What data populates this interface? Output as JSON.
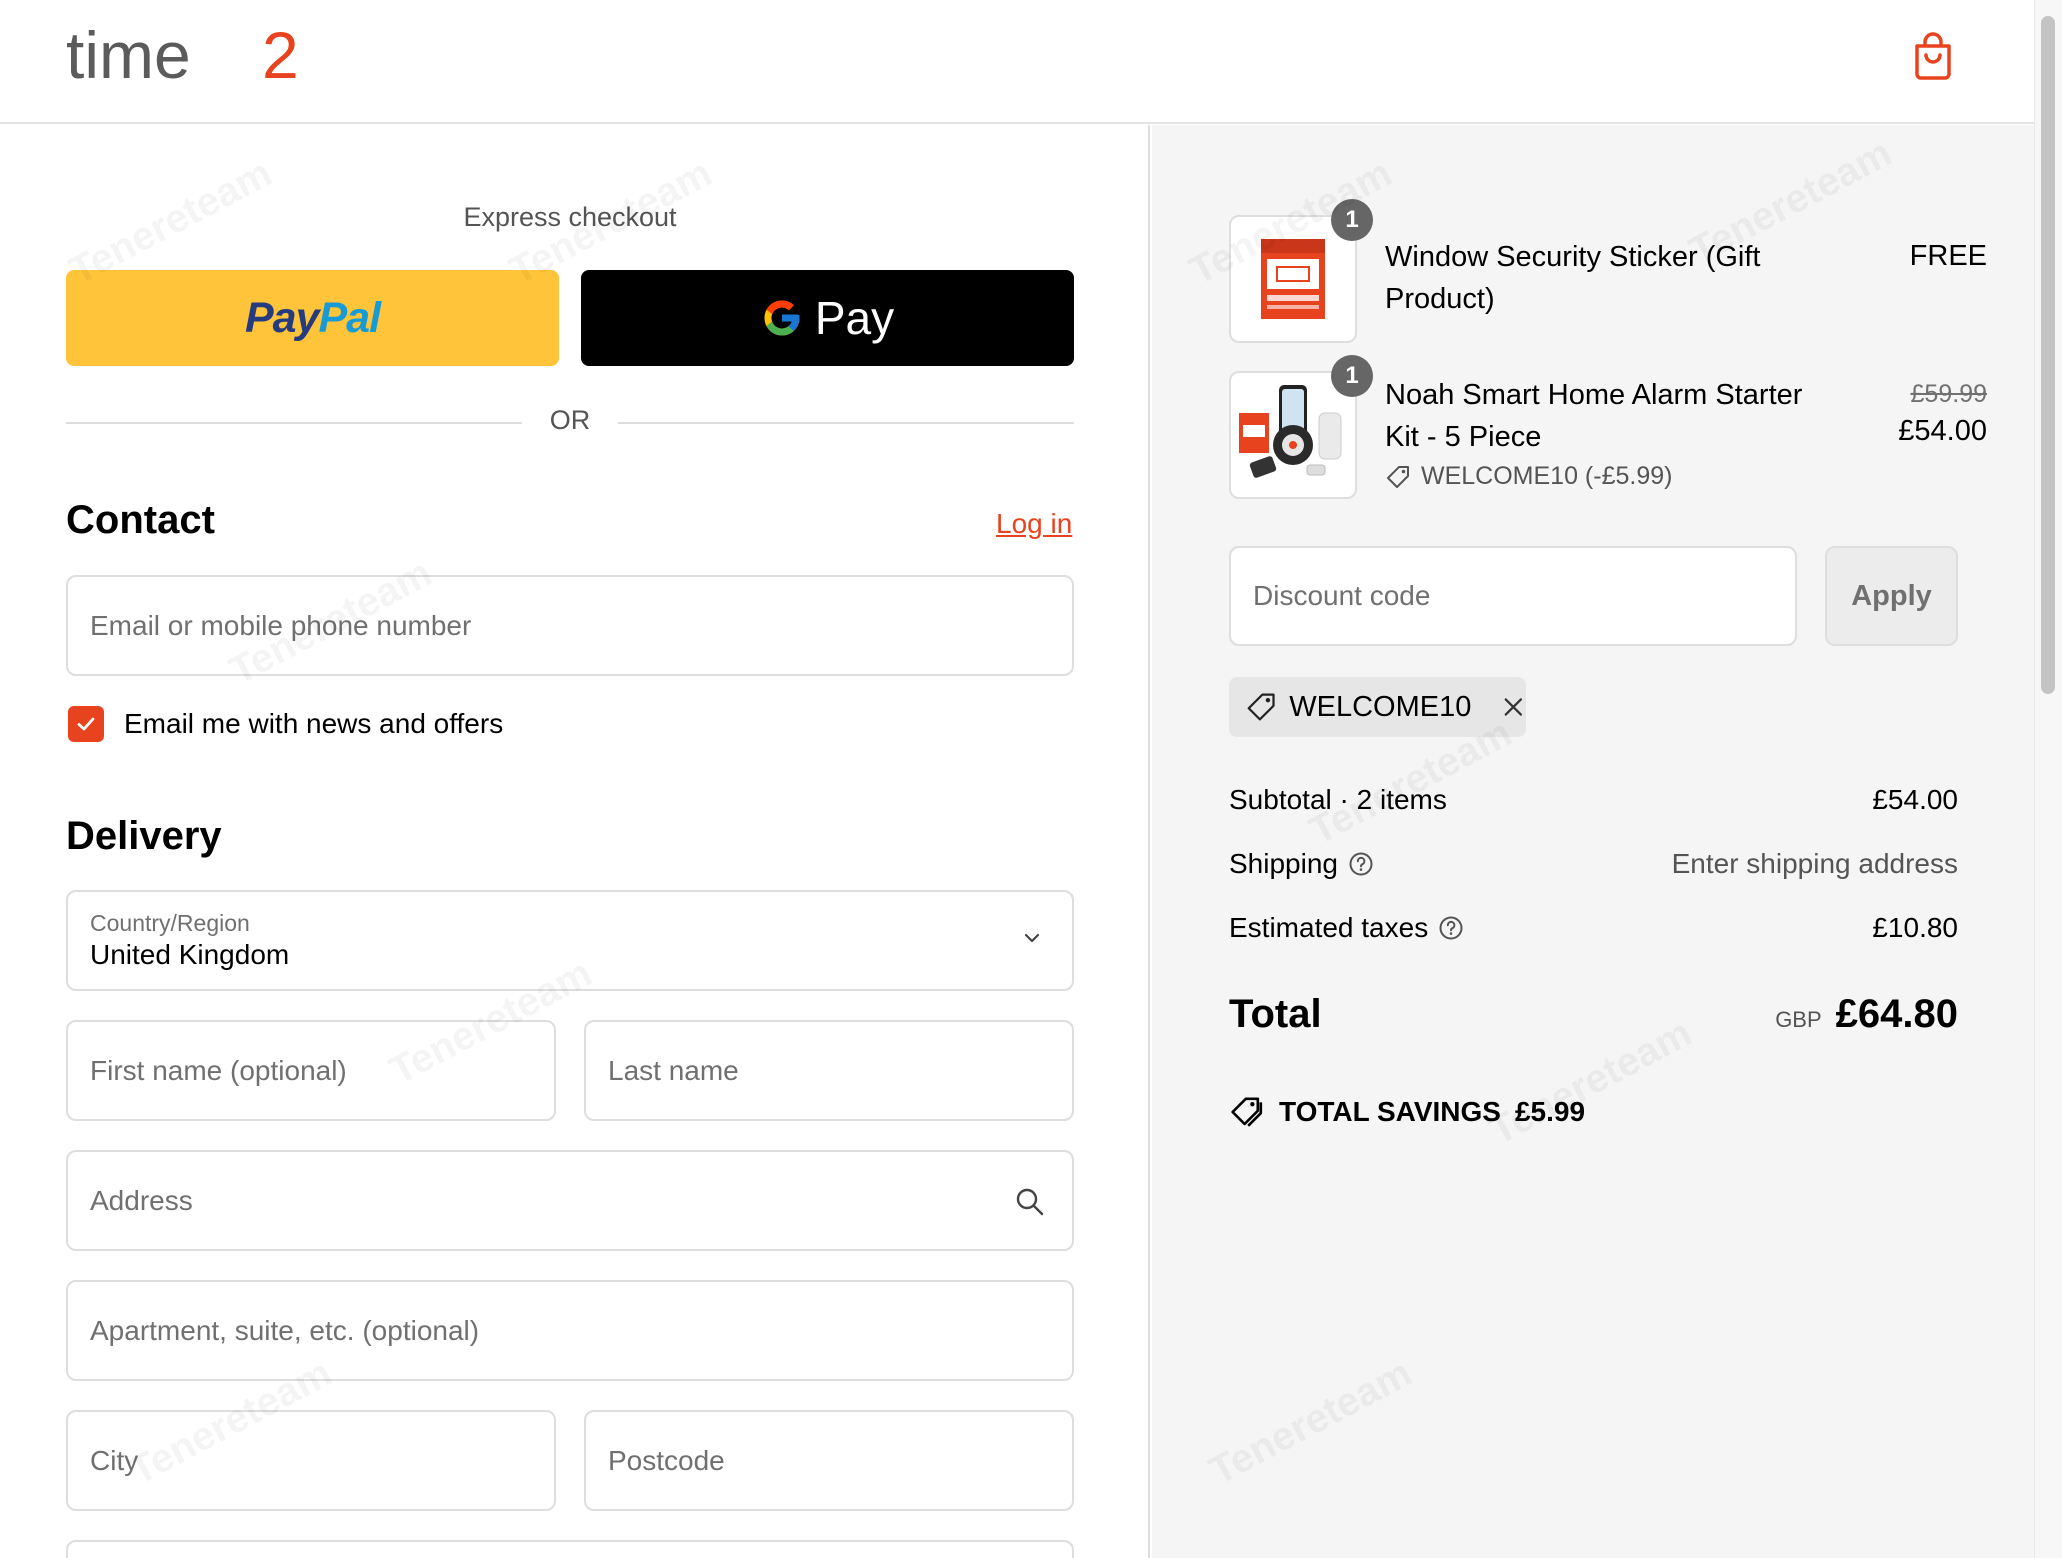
{
  "header": {
    "logo_text_dark": "time",
    "logo_text_accent": "2",
    "cart_icon": "shopping-bag-icon"
  },
  "express": {
    "label": "Express checkout",
    "paypal_label_1": "Pay",
    "paypal_label_2": "Pal",
    "gpay_label": "Pay",
    "or_label": "OR"
  },
  "contact": {
    "title": "Contact",
    "login_label": "Log in",
    "email_placeholder": "Email or mobile phone number",
    "newsletter_label": "Email me with news and offers",
    "newsletter_checked": true
  },
  "delivery": {
    "title": "Delivery",
    "country_label": "Country/Region",
    "country_value": "United Kingdom",
    "first_name_placeholder": "First name (optional)",
    "last_name_placeholder": "Last name",
    "address_placeholder": "Address",
    "apartment_placeholder": "Apartment, suite, etc. (optional)",
    "city_placeholder": "City",
    "postcode_placeholder": "Postcode"
  },
  "cart": {
    "items": [
      {
        "name_line1": "Window Security Sticker (Gift",
        "name_line2": "Product)",
        "qty": "1",
        "price": "FREE"
      },
      {
        "name_line1": "Noah Smart Home Alarm Starter",
        "name_line2": "Kit - 5 Piece",
        "qty": "1",
        "original_price": "£59.99",
        "price": "£54.00",
        "discount_label": "WELCOME10 (-£5.99)"
      }
    ],
    "discount_placeholder": "Discount code",
    "apply_label": "Apply",
    "applied_code": "WELCOME10"
  },
  "summary": {
    "subtotal_label": "Subtotal · 2 items",
    "subtotal_value": "£54.00",
    "shipping_label": "Shipping",
    "shipping_value": "Enter shipping address",
    "taxes_label": "Estimated taxes",
    "taxes_value": "£10.80",
    "total_label": "Total",
    "currency": "GBP",
    "total_value": "£64.80",
    "savings_label": "TOTAL SAVINGS",
    "savings_value": "£5.99"
  },
  "colors": {
    "accent": "#e8431f",
    "paypal_yellow": "#ffc439",
    "gpay_black": "#000000",
    "summary_bg": "#f5f5f5"
  },
  "watermark": "Tenereteam"
}
